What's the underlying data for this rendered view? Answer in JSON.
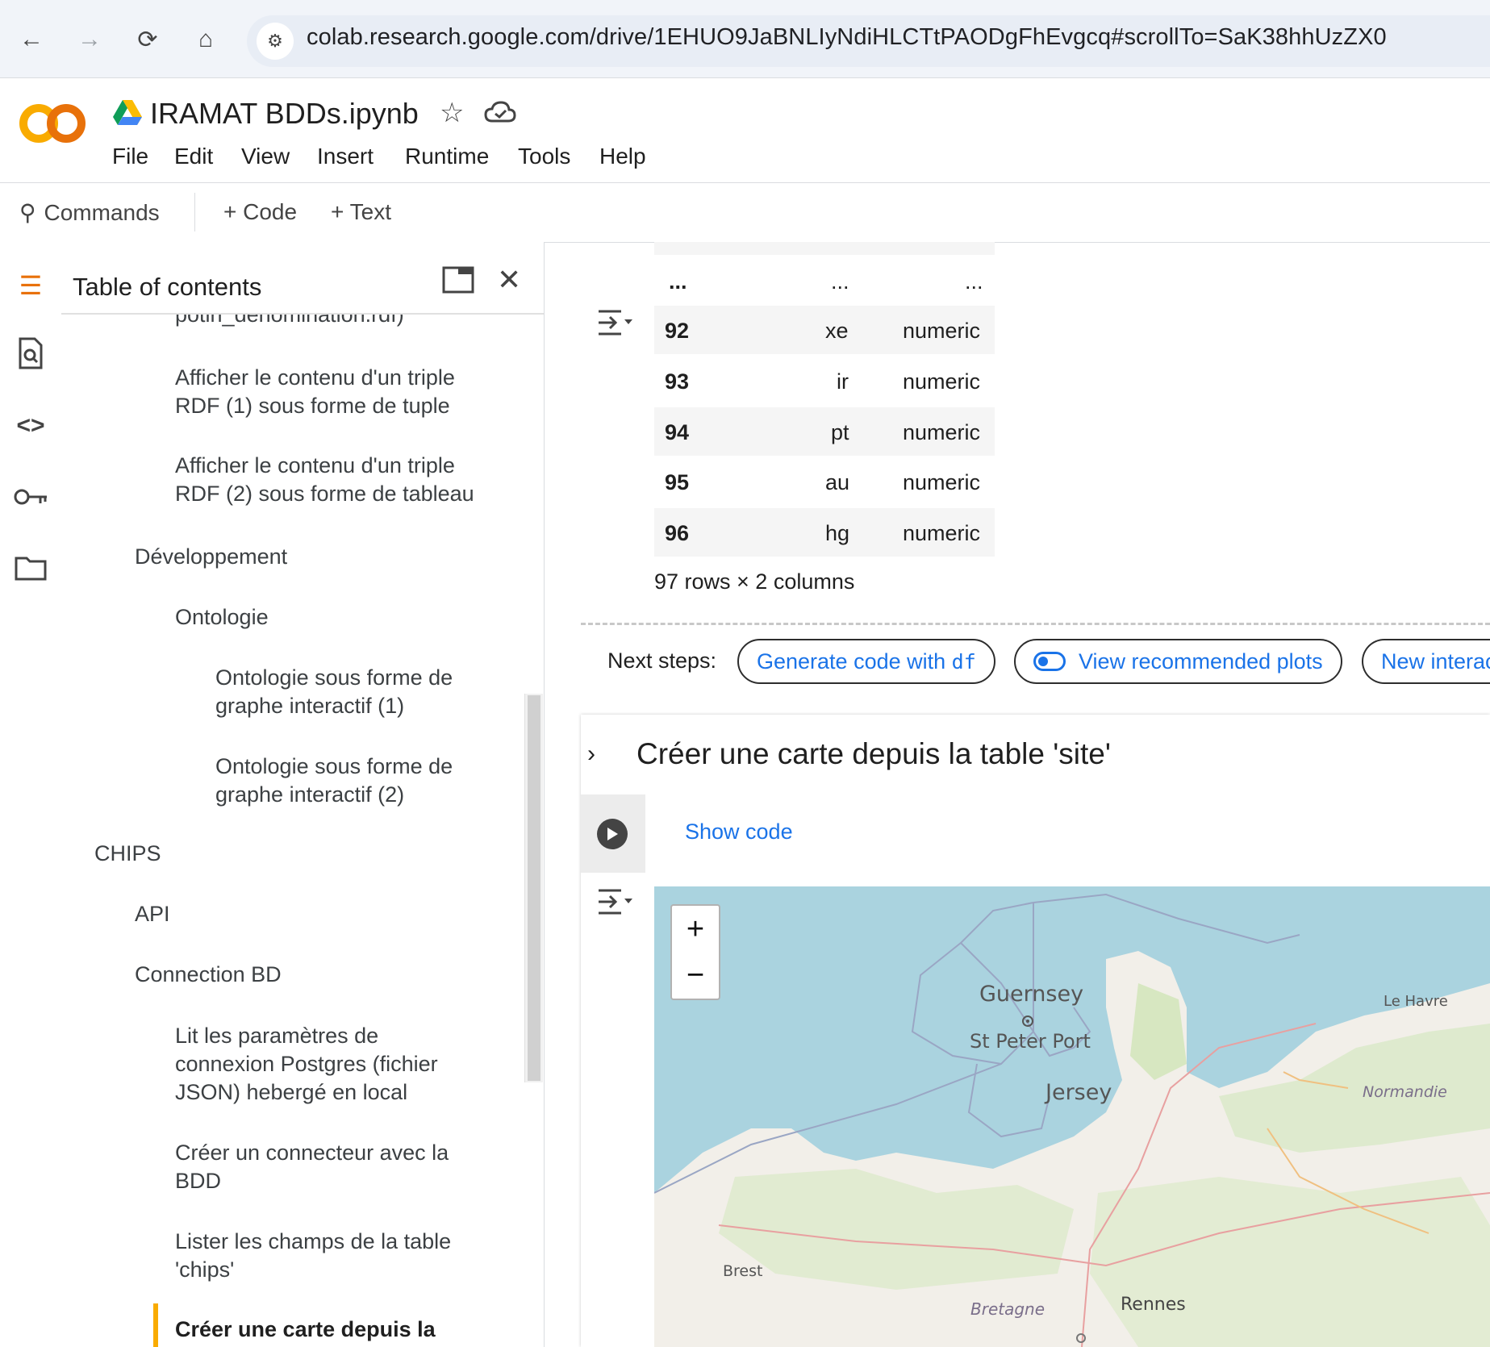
{
  "browser": {
    "url": "colab.research.google.com/drive/1EHUO9JaBNLIyNdiHLCTtPAODgFhEvgcq#scrollTo=SaK38hhUzZX0"
  },
  "notebook": {
    "title": "IRAMAT BDDs.ipynb",
    "menu": [
      "File",
      "Edit",
      "View",
      "Insert",
      "Runtime",
      "Tools",
      "Help"
    ]
  },
  "toolbar": {
    "commands": "Commands",
    "code": "+ Code",
    "text": "+ Text"
  },
  "toc": {
    "heading": "Table of contents",
    "items": [
      {
        "label": "potin_denomination.rdf)"
      },
      {
        "label": "Afficher le contenu d'un triple RDF (1) sous forme de tuple"
      },
      {
        "label": "Afficher le contenu d'un triple RDF (2) sous forme de tableau"
      },
      {
        "label": "Développement"
      },
      {
        "label": "Ontologie"
      },
      {
        "label": "Ontologie sous forme de graphe interactif (1)"
      },
      {
        "label": "Ontologie sous forme de graphe interactif (2)"
      },
      {
        "label": "CHIPS"
      },
      {
        "label": "API"
      },
      {
        "label": "Connection BD"
      },
      {
        "label": "Lit les paramètres de connexion Postgres (fichier JSON) hebergé en local"
      },
      {
        "label": "Créer un connecteur avec la BDD"
      },
      {
        "label": "Lister les champs de la table 'chips'"
      },
      {
        "label": "Créer une carte depuis la"
      }
    ]
  },
  "table": {
    "ellipsis": [
      "...",
      "...",
      "..."
    ],
    "rows": [
      {
        "index": "92",
        "name": "xe",
        "type": "numeric"
      },
      {
        "index": "93",
        "name": "ir",
        "type": "numeric"
      },
      {
        "index": "94",
        "name": "pt",
        "type": "numeric"
      },
      {
        "index": "95",
        "name": "au",
        "type": "numeric"
      },
      {
        "index": "96",
        "name": "hg",
        "type": "numeric"
      }
    ],
    "summary": "97 rows × 2 columns"
  },
  "next_steps": {
    "label": "Next steps:",
    "generate": "Generate code with ",
    "generate_code": "df",
    "plots": "View recommended plots",
    "new": "New interac"
  },
  "section": {
    "title": "Créer une carte depuis la table 'site'",
    "show_code": "Show code"
  },
  "map": {
    "zoom_in": "+",
    "zoom_out": "−",
    "labels": [
      "Guernsey",
      "St Peter Port",
      "Jersey",
      "Le Havre",
      "Normandie",
      "Brest",
      "Bretagne",
      "Rennes"
    ]
  },
  "icons": {
    "back": "arrow-left",
    "forward": "arrow-right",
    "reload": "reload",
    "home": "home",
    "site_info": "tune",
    "star": "star",
    "cloud": "cloud",
    "search": "search",
    "toc": "list",
    "find": "find-replace",
    "code": "code",
    "key": "key",
    "folder": "folder",
    "close": "close",
    "popout": "open-window",
    "output": "output-toggle",
    "play": "play",
    "chevron": "chevron-right"
  },
  "colors": {
    "accent": "#1a73e8",
    "toc_active": "#f9ab00",
    "marker": "#2a81cb",
    "sea": "#aad3df",
    "land": "#f2efe9"
  }
}
